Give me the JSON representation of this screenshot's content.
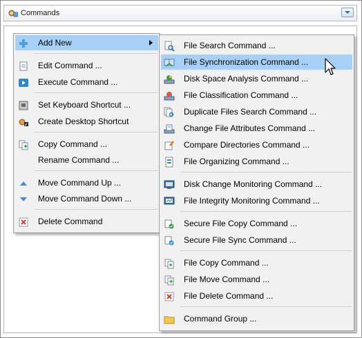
{
  "header": {
    "title": "Commands"
  },
  "context_menu": {
    "items": [
      {
        "label": "Add New",
        "icon": "add-icon"
      },
      {
        "label": "Edit Command ...",
        "icon": "edit-icon"
      },
      {
        "label": "Execute Command ...",
        "icon": "execute-icon"
      },
      {
        "label": "Set Keyboard Shortcut ...",
        "icon": "keyboard-icon"
      },
      {
        "label": "Create Desktop Shortcut",
        "icon": "desktop-shortcut-icon"
      },
      {
        "label": "Copy Command ...",
        "icon": "copy-icon"
      },
      {
        "label": "Rename Command ...",
        "icon": ""
      },
      {
        "label": "Move Command Up ...",
        "icon": "arrow-up-icon"
      },
      {
        "label": "Move Command Down ...",
        "icon": "arrow-down-icon"
      },
      {
        "label": "Delete Command",
        "icon": "delete-icon"
      }
    ]
  },
  "submenu": {
    "items": [
      {
        "label": "File Search Command ...",
        "icon": "file-search-icon"
      },
      {
        "label": "File Synchronization Command ...",
        "icon": "file-sync-icon"
      },
      {
        "label": "Disk Space Analysis Command ...",
        "icon": "disk-space-icon"
      },
      {
        "label": "File Classification Command ...",
        "icon": "classification-icon"
      },
      {
        "label": "Duplicate Files Search Command ...",
        "icon": "duplicate-search-icon"
      },
      {
        "label": "Change File Attributes Command ...",
        "icon": "attributes-icon"
      },
      {
        "label": "Compare Directories Command ...",
        "icon": "compare-icon"
      },
      {
        "label": "File Organizing Command ...",
        "icon": "organizing-icon"
      },
      {
        "label": "Disk Change Monitoring Command ...",
        "icon": "change-monitor-icon"
      },
      {
        "label": "File Integrity Monitoring Command ...",
        "icon": "integrity-monitor-icon"
      },
      {
        "label": "Secure File Copy Command ...",
        "icon": "secure-copy-icon"
      },
      {
        "label": "Secure File Sync Command ...",
        "icon": "secure-sync-icon"
      },
      {
        "label": "File Copy Command ...",
        "icon": "file-copy-icon"
      },
      {
        "label": "File Move Command ...",
        "icon": "file-move-icon"
      },
      {
        "label": "File Delete Command ...",
        "icon": "file-delete-icon"
      },
      {
        "label": "Command Group ...",
        "icon": "folder-icon"
      }
    ],
    "highlighted": "File Synchronization Command ..."
  },
  "colors": {
    "highlight": "#a6d0f6",
    "menu_bg": "#f1f1f1",
    "accent": "#3a7bd5"
  }
}
